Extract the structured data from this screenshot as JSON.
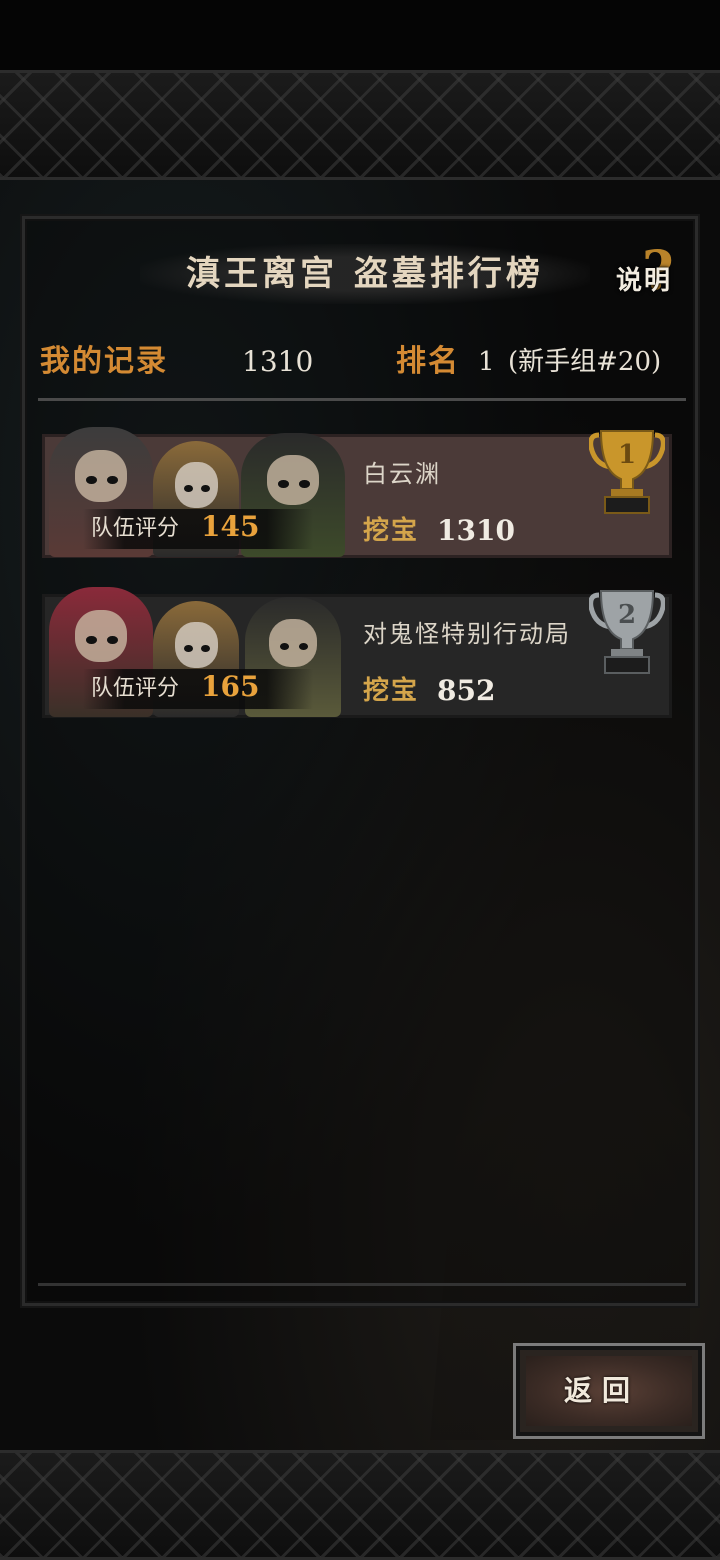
{
  "header": {
    "title": "滇王离宫 盗墓排行榜",
    "help_label": "说明",
    "help_glyph": "?"
  },
  "my_record": {
    "label": "我的记录",
    "score": "1310",
    "rank_label": "排名",
    "rank_value": "1",
    "rank_group": "(新手组#20)"
  },
  "entries": [
    {
      "rank": 1,
      "team_name": "白云渊",
      "team_score_label": "队伍评分",
      "team_score": "145",
      "treasure_label": "挖宝",
      "treasure_value": "1310",
      "trophy": "gold-trophy-icon",
      "trophy_number": "1"
    },
    {
      "rank": 2,
      "team_name": "对鬼怪特别行动局",
      "team_score_label": "队伍评分",
      "team_score": "165",
      "treasure_label": "挖宝",
      "treasure_value": "852",
      "trophy": "silver-trophy-icon",
      "trophy_number": "2"
    }
  ],
  "footer": {
    "back_label": "返回"
  },
  "colors": {
    "accent_orange": "#d48a33",
    "gold": "#c9962b",
    "silver": "#9ea3a6",
    "first_row_bg": "#4b3a38",
    "second_row_bg": "#262626"
  }
}
